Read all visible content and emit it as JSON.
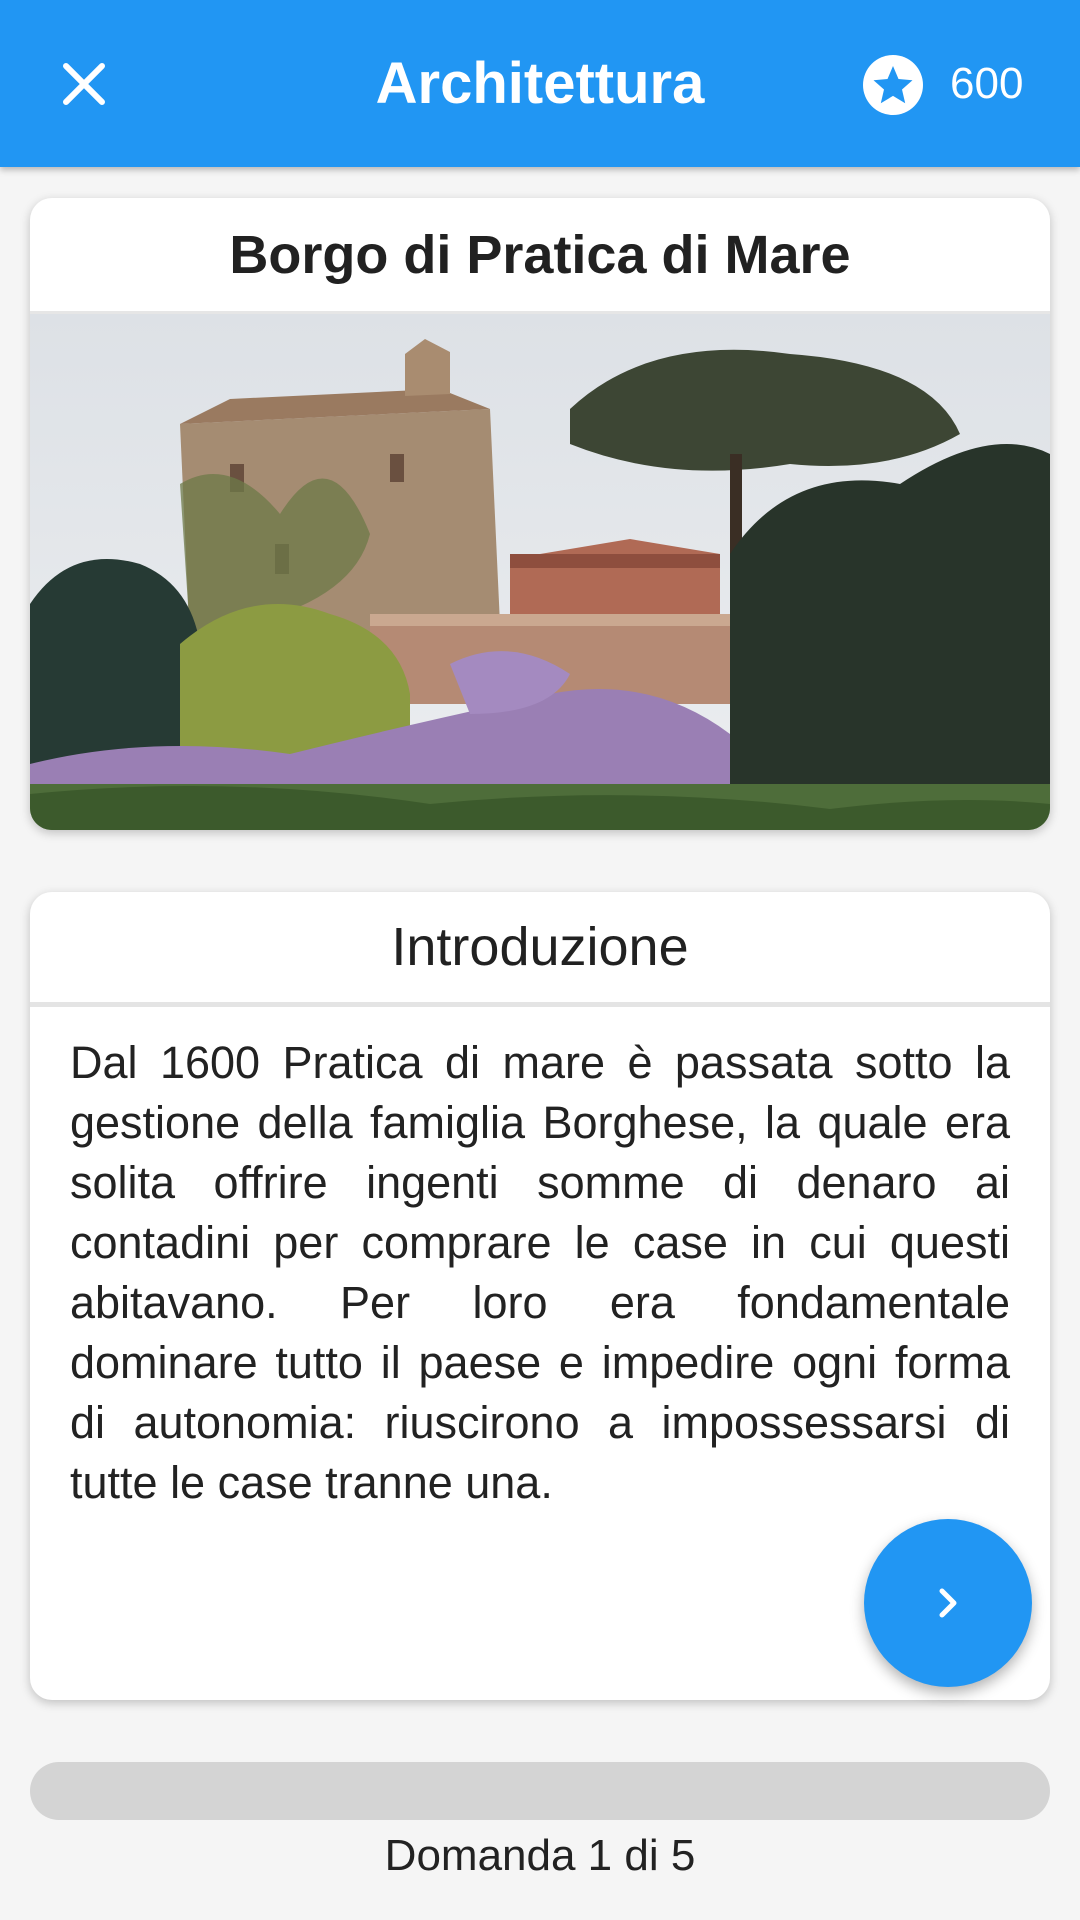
{
  "appbar": {
    "title": "Architettura",
    "close_icon": "close-icon",
    "score_icon": "star-circle-icon",
    "score": "600"
  },
  "card_image": {
    "title": "Borgo di Pratica di Mare"
  },
  "card_text": {
    "title": "Introduzione",
    "body": "Dal 1600 Pratica di mare è passata sotto la gestione della famiglia Borghese, la quale era solita offrire ingenti somme di denaro ai contadini per comprare le case in cui questi abitavano. Per loro era fondamentale dominare tutto il paese e impedire ogni forma di autonomia: riuscirono a impossessarsi di tutte le case tranne una."
  },
  "next_button": {
    "icon": "chevron-right-icon"
  },
  "progress": {
    "label": "Domanda 1 di 5",
    "fraction": 0
  },
  "colors": {
    "primary": "#2196f3",
    "track": "#d4d4d4"
  }
}
